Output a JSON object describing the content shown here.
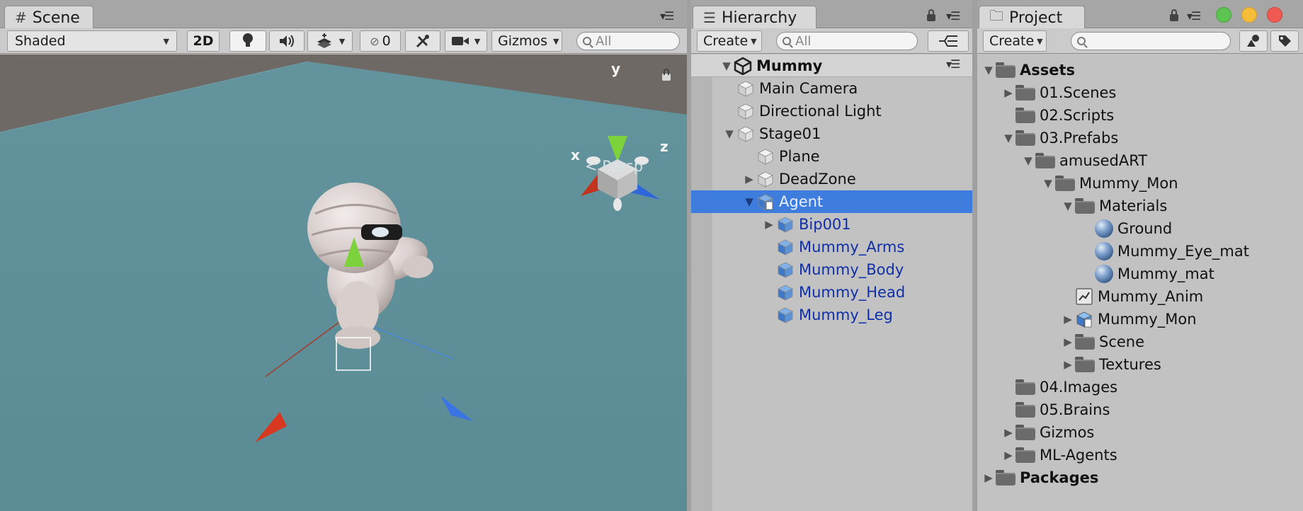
{
  "scene": {
    "tab_title": "Scene",
    "shading_mode": "Shaded",
    "btn_2d": "2D",
    "hidden_count": "0",
    "gizmos_label": "Gizmos",
    "search_placeholder": "All",
    "projection_label": "Persp",
    "axis_labels": {
      "x": "x",
      "y": "y",
      "z": "z"
    },
    "colors": {
      "ground": "#5e8f98",
      "sky": "#6f6964",
      "x_axis": "#d0361c",
      "y_axis": "#7fd53a",
      "z_axis": "#2f6ae0"
    }
  },
  "hierarchy": {
    "tab_title": "Hierarchy",
    "create_label": "Create",
    "search_placeholder": "All",
    "scene_name": "Mummy",
    "items": [
      {
        "label": "Main Camera",
        "depth": 1,
        "arrow": "",
        "prefab": false,
        "selected": false
      },
      {
        "label": "Directional Light",
        "depth": 1,
        "arrow": "",
        "prefab": false,
        "selected": false
      },
      {
        "label": "Stage01",
        "depth": 1,
        "arrow": "expanded",
        "prefab": false,
        "selected": false
      },
      {
        "label": "Plane",
        "depth": 2,
        "arrow": "",
        "prefab": false,
        "selected": false
      },
      {
        "label": "DeadZone",
        "depth": 2,
        "arrow": "collapsed",
        "prefab": false,
        "selected": false
      },
      {
        "label": "Agent",
        "depth": 2,
        "arrow": "expanded",
        "prefab": true,
        "selected": true
      },
      {
        "label": "Bip001",
        "depth": 3,
        "arrow": "collapsed",
        "prefab": true,
        "selected": false
      },
      {
        "label": "Mummy_Arms",
        "depth": 3,
        "arrow": "",
        "prefab": true,
        "selected": false
      },
      {
        "label": "Mummy_Body",
        "depth": 3,
        "arrow": "",
        "prefab": true,
        "selected": false
      },
      {
        "label": "Mummy_Head",
        "depth": 3,
        "arrow": "",
        "prefab": true,
        "selected": false
      },
      {
        "label": "Mummy_Leg",
        "depth": 3,
        "arrow": "",
        "prefab": true,
        "selected": false
      }
    ]
  },
  "project": {
    "tab_title": "Project",
    "create_label": "Create",
    "search_placeholder": "",
    "items": [
      {
        "label": "Assets",
        "depth": 0,
        "arrow": "expanded",
        "icon": "folder",
        "bold": true
      },
      {
        "label": "01.Scenes",
        "depth": 1,
        "arrow": "collapsed",
        "icon": "folder",
        "bold": false
      },
      {
        "label": "02.Scripts",
        "depth": 1,
        "arrow": "",
        "icon": "folder",
        "bold": false
      },
      {
        "label": "03.Prefabs",
        "depth": 1,
        "arrow": "expanded",
        "icon": "folder",
        "bold": false
      },
      {
        "label": "amusedART",
        "depth": 2,
        "arrow": "expanded",
        "icon": "folder",
        "bold": false
      },
      {
        "label": "Mummy_Mon",
        "depth": 3,
        "arrow": "expanded",
        "icon": "folder",
        "bold": false
      },
      {
        "label": "Materials",
        "depth": 4,
        "arrow": "expanded",
        "icon": "folder",
        "bold": false
      },
      {
        "label": "Ground",
        "depth": 5,
        "arrow": "",
        "icon": "material",
        "bold": false
      },
      {
        "label": "Mummy_Eye_mat",
        "depth": 5,
        "arrow": "",
        "icon": "material",
        "bold": false
      },
      {
        "label": "Mummy_mat",
        "depth": 5,
        "arrow": "",
        "icon": "material",
        "bold": false
      },
      {
        "label": "Mummy_Anim",
        "depth": 4,
        "arrow": "",
        "icon": "animator",
        "bold": false
      },
      {
        "label": "Mummy_Mon",
        "depth": 4,
        "arrow": "collapsed",
        "icon": "prefab",
        "bold": false
      },
      {
        "label": "Scene",
        "depth": 4,
        "arrow": "collapsed",
        "icon": "folder",
        "bold": false
      },
      {
        "label": "Textures",
        "depth": 4,
        "arrow": "collapsed",
        "icon": "folder",
        "bold": false
      },
      {
        "label": "04.Images",
        "depth": 1,
        "arrow": "",
        "icon": "folder",
        "bold": false
      },
      {
        "label": "05.Brains",
        "depth": 1,
        "arrow": "",
        "icon": "folder",
        "bold": false
      },
      {
        "label": "Gizmos",
        "depth": 1,
        "arrow": "collapsed",
        "icon": "folder",
        "bold": false
      },
      {
        "label": "ML-Agents",
        "depth": 1,
        "arrow": "collapsed",
        "icon": "folder",
        "bold": false
      },
      {
        "label": "Packages",
        "depth": 0,
        "arrow": "collapsed",
        "icon": "folder",
        "bold": true
      }
    ]
  },
  "window_controls": {
    "close": "#ef5a52",
    "minimize": "#f5bd3a",
    "zoom": "#5ec451"
  }
}
